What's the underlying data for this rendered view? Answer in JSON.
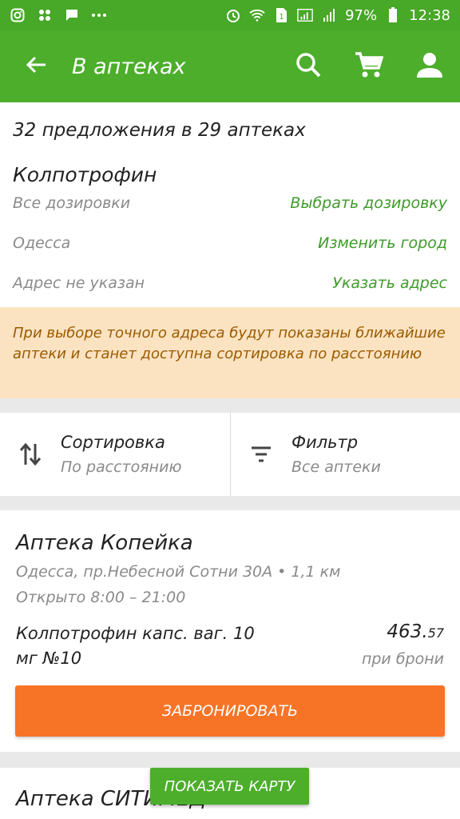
{
  "status_bar": {
    "battery": "97%",
    "time": "12:38",
    "icons": [
      "instagram-icon",
      "hashtag-icon",
      "message-icon",
      "more-icon",
      "alarm-icon",
      "wifi-icon",
      "sim-icon",
      "signal-icon",
      "battery-icon"
    ]
  },
  "app_bar": {
    "title": "В аптеках",
    "icons": [
      "back-arrow-icon",
      "search-icon",
      "cart-icon",
      "account-icon"
    ]
  },
  "header": {
    "offers_summary": "32 предложения в 29 аптеках",
    "drug_name": "Колпотрофин",
    "rows": [
      {
        "label": "Все дозировки",
        "action": "Выбрать дозировку"
      },
      {
        "label": "Одесса",
        "action": "Изменить город"
      },
      {
        "label": "Адрес не указан",
        "action": "Указать адрес"
      }
    ]
  },
  "notice": {
    "text": "При выборе точного адреса будут показаны ближайшие аптеки и станет доступна сортировка по расстоянию"
  },
  "sort_bar": {
    "sort": {
      "title": "Сортировка",
      "value": "По расстоянию",
      "icon": "sort-arrows-icon"
    },
    "filter": {
      "title": "Фильтр",
      "value": "Все аптеки",
      "icon": "filter-icon"
    }
  },
  "pharmacies": [
    {
      "name": "Аптека Копейка",
      "address": "Одесса, пр.Небесной Сотни 30А • 1,1 км",
      "hours": "Открыто 8:00 – 21:00",
      "product": "Колпотрофин капс. ваг. 10 мг №10",
      "price_main": "463.",
      "price_cents": "57",
      "price_note": "при брони",
      "button": "ЗАБРОНИРОВАТЬ"
    },
    {
      "name": "Аптека СИТИМЕД"
    }
  ],
  "map_button": "ПОКАЗАТЬ КАРТУ",
  "colors": {
    "primary_green": "#4cae2b",
    "accent_orange": "#f77426",
    "link_green": "#3f9b2a",
    "notice_bg": "#fbe3c1",
    "notice_text": "#9b5a00"
  }
}
